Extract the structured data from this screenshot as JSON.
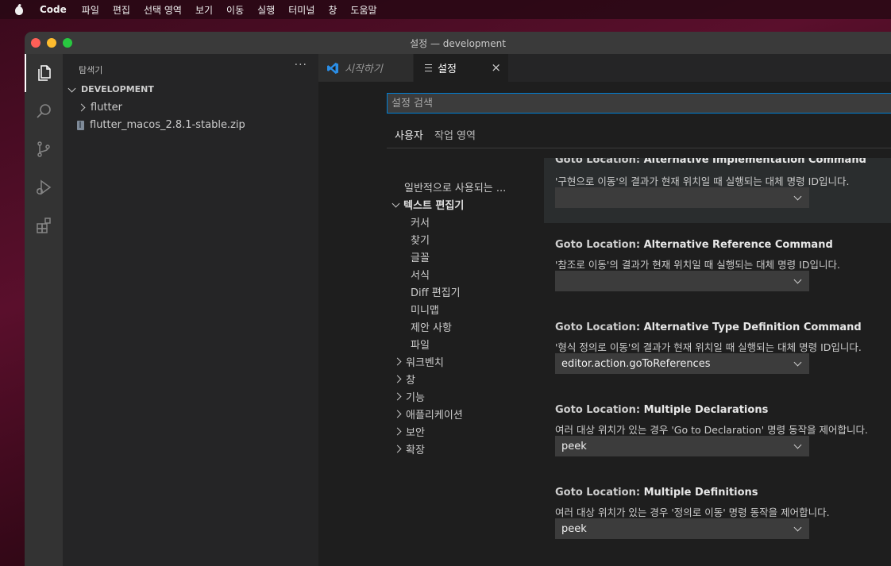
{
  "menubar": {
    "items": [
      "Code",
      "파일",
      "편집",
      "선택 영역",
      "보기",
      "이동",
      "실행",
      "터미널",
      "창",
      "도움말"
    ]
  },
  "window": {
    "title": "설정 — development"
  },
  "activity_bar": {
    "icons": [
      "explorer-icon",
      "search-icon",
      "source-control-icon",
      "run-debug-icon",
      "extensions-icon"
    ]
  },
  "sidebar": {
    "title": "탐색기",
    "more": "···",
    "section": "DEVELOPMENT",
    "items": [
      {
        "label": "flutter",
        "type": "folder"
      },
      {
        "label": "flutter_macos_2.8.1-stable.zip",
        "type": "file"
      }
    ]
  },
  "tabs": [
    {
      "label": "시작하기",
      "active": false
    },
    {
      "label": "설정",
      "active": true,
      "close": "×"
    }
  ],
  "settings_editor": {
    "search_placeholder": "설정 검색",
    "scopes": [
      "사용자",
      "작업 영역"
    ],
    "toc": [
      {
        "label": "일반적으로 사용되는 ..."
      },
      {
        "label": "텍스트 편집기",
        "expanded": true
      },
      {
        "label": "커서"
      },
      {
        "label": "찾기"
      },
      {
        "label": "글꼴"
      },
      {
        "label": "서식"
      },
      {
        "label": "Diff 편집기"
      },
      {
        "label": "미니맵"
      },
      {
        "label": "제안 사항"
      },
      {
        "label": "파일"
      },
      {
        "label": "워크벤치"
      },
      {
        "label": "창"
      },
      {
        "label": "기능"
      },
      {
        "label": "애플리케이션"
      },
      {
        "label": "보안"
      },
      {
        "label": "확장"
      }
    ],
    "settings": [
      {
        "category": "Goto Location: ",
        "name": "Alternative Implementation Command",
        "description": "'구현으로 이동'의 결과가 현재 위치일 때 실행되는 대체 명령 ID입니다.",
        "value": ""
      },
      {
        "category": "Goto Location: ",
        "name": "Alternative Reference Command",
        "description": "'참조로 이동'의 결과가 현재 위치일 때 실행되는 대체 명령 ID입니다.",
        "value": ""
      },
      {
        "category": "Goto Location: ",
        "name": "Alternative Type Definition Command",
        "description": "'형식 정의로 이동'의 결과가 현재 위치일 때 실행되는 대체 명령 ID입니다.",
        "value": "editor.action.goToReferences"
      },
      {
        "category": "Goto Location: ",
        "name": "Multiple Declarations",
        "description": "여러 대상 위치가 있는 경우 'Go to Declaration' 명령 동작을 제어합니다.",
        "value": "peek"
      },
      {
        "category": "Goto Location: ",
        "name": "Multiple Definitions",
        "description": "여러 대상 위치가 있는 경우 '정의로 이동' 명령 동작을 제어합니다.",
        "value": "peek"
      }
    ]
  }
}
